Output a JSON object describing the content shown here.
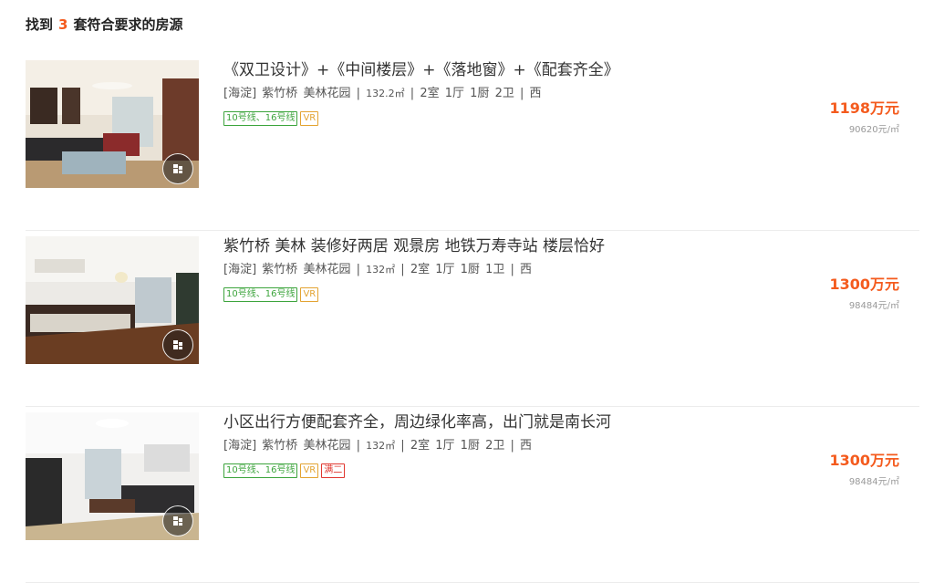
{
  "summary": {
    "prefix": "找到",
    "count": "3",
    "suffix": "套符合要求的房源"
  },
  "listings": [
    {
      "title": "《双卫设计》+《中间楼层》+《落地窗》+《配套齐全》",
      "district": "[海淀]",
      "area_name": "紫竹桥",
      "community": "美林花园",
      "size": "132.2㎡",
      "rooms": "2室",
      "halls": "1厅",
      "kitchens": "1厨",
      "baths": "2卫",
      "orientation": "西",
      "tags": [
        "10号线、16号线",
        "VR"
      ],
      "total_price": "1198万元",
      "unit_price": "90620元/㎡"
    },
    {
      "title": "紫竹桥 美林 装修好两居 观景房 地铁万寿寺站 楼层恰好",
      "district": "[海淀]",
      "area_name": "紫竹桥",
      "community": "美林花园",
      "size": "132㎡",
      "rooms": "2室",
      "halls": "1厅",
      "kitchens": "1厨",
      "baths": "1卫",
      "orientation": "西",
      "tags": [
        "10号线、16号线",
        "VR"
      ],
      "total_price": "1300万元",
      "unit_price": "98484元/㎡"
    },
    {
      "title": "小区出行方便配套齐全，周边绿化率高，出门就是南长河",
      "district": "[海淀]",
      "area_name": "紫竹桥",
      "community": "美林花园",
      "size": "132㎡",
      "rooms": "2室",
      "halls": "1厅",
      "kitchens": "1厨",
      "baths": "2卫",
      "orientation": "西",
      "tags": [
        "10号线、16号线",
        "VR",
        "满二"
      ],
      "total_price": "1300万元",
      "unit_price": "98484元/㎡"
    }
  ],
  "colors": {
    "accent": "#f45b1e",
    "subway_tag": "#3ca43c",
    "vr_tag": "#e3a331",
    "red_tag": "#e0372f"
  }
}
